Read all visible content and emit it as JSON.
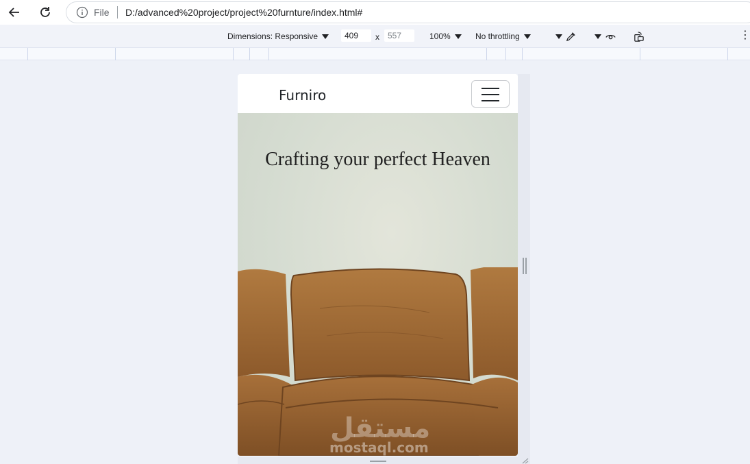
{
  "browser": {
    "file_label": "File",
    "url": "D:/advanced%20project/project%20furnture/index.html#"
  },
  "devtools": {
    "dimensions_label": "Dimensions: Responsive",
    "width": "409",
    "separator": "x",
    "height": "557",
    "zoom": "100%",
    "throttling": "No throttling",
    "more_icon": "⋮"
  },
  "site": {
    "brand": "Furniro",
    "hero_title": "Crafting your perfect Heaven",
    "colors": {
      "sofa_leather": "#9a6632",
      "hero_background": "#d5dcd1"
    }
  },
  "watermark": {
    "arabic": "مستقل",
    "latin": "mostaql.com"
  }
}
